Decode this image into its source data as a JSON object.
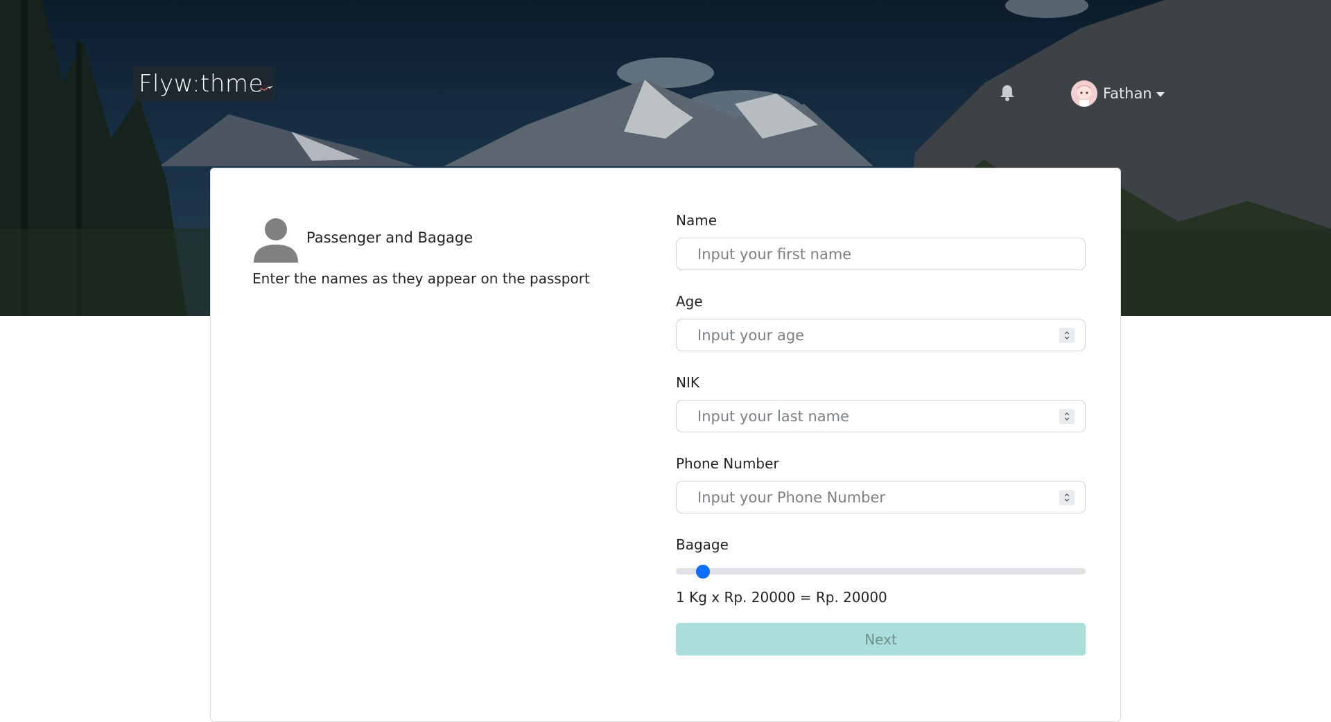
{
  "navbar": {
    "logo_text": "Flyw:thme",
    "user_name": "Fathan"
  },
  "section": {
    "title": "Passenger and Bagage",
    "subtitle": "Enter the names as they appear on the passport"
  },
  "form": {
    "name": {
      "label": "Name",
      "placeholder": "Input your first name",
      "value": ""
    },
    "age": {
      "label": "Age",
      "placeholder": "Input your age",
      "value": ""
    },
    "nik": {
      "label": "NIK",
      "placeholder": "Input your last name",
      "value": ""
    },
    "phone": {
      "label": "Phone Number",
      "placeholder": "Input your Phone Number",
      "value": ""
    },
    "bagage": {
      "label": "Bagage",
      "value_kg": 1,
      "calculation": "1 Kg x Rp. 20000 = Rp. 20000"
    },
    "next_label": "Next"
  },
  "colors": {
    "accent": "#0d6efd",
    "next_button": "#a9deda"
  },
  "icons": [
    "bell-icon",
    "avatar",
    "person-icon",
    "plane-icon",
    "caret-down-icon"
  ]
}
